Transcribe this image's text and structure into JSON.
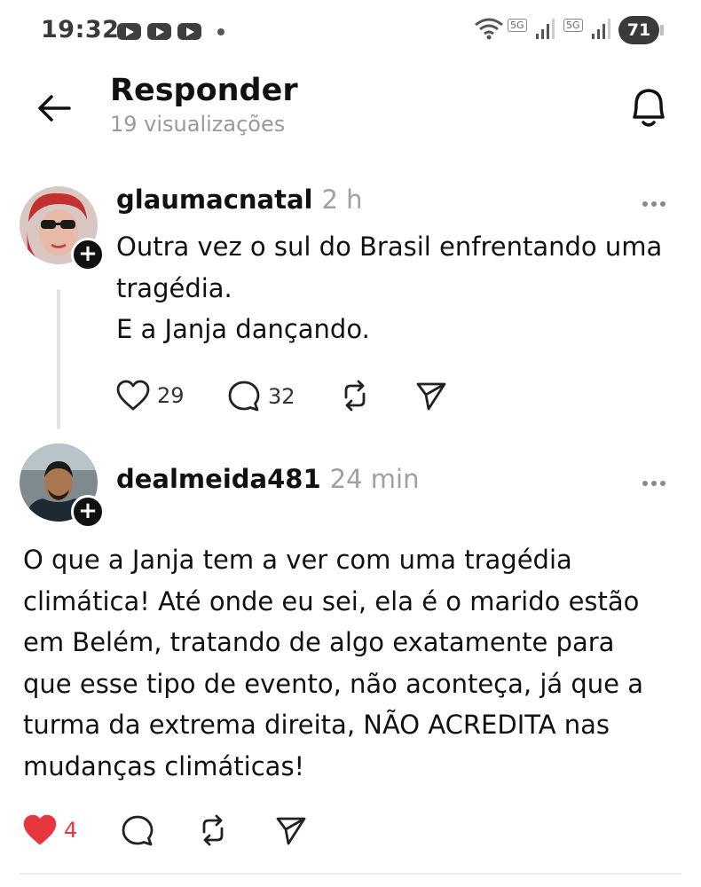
{
  "status_bar": {
    "time": "19:32",
    "network_1": "5G",
    "network_2": "5G",
    "battery": "71"
  },
  "header": {
    "title": "Responder",
    "views": "19 visualizações"
  },
  "posts": [
    {
      "username": "glaumacnatal",
      "time_ago": "2 h",
      "lines": [
        "Outra vez o sul do Brasil enfrentando uma",
        "tragédia.",
        "E a Janja dançando."
      ],
      "likes": "29",
      "comments": "32"
    },
    {
      "username": "dealmeida481",
      "time_ago": "24 min",
      "lines": [
        "O que a Janja tem a ver com uma tragédia",
        "climática! Até onde eu sei, ela é o marido estão",
        "em Belém, tratando de algo exatamente para",
        "que esse tipo de evento, não aconteça, já que a",
        "turma da extrema direita, NÃO ACREDITA nas",
        "mudanças climáticas!"
      ],
      "likes": "4",
      "liked": true
    }
  ],
  "colors": {
    "like_active": "#e8363f",
    "muted": "#9a9a9a"
  },
  "icons": [
    "back-arrow-icon",
    "bell-icon",
    "heart-icon",
    "comment-icon",
    "repost-icon",
    "share-icon",
    "more-icon",
    "follow-plus-icon"
  ]
}
